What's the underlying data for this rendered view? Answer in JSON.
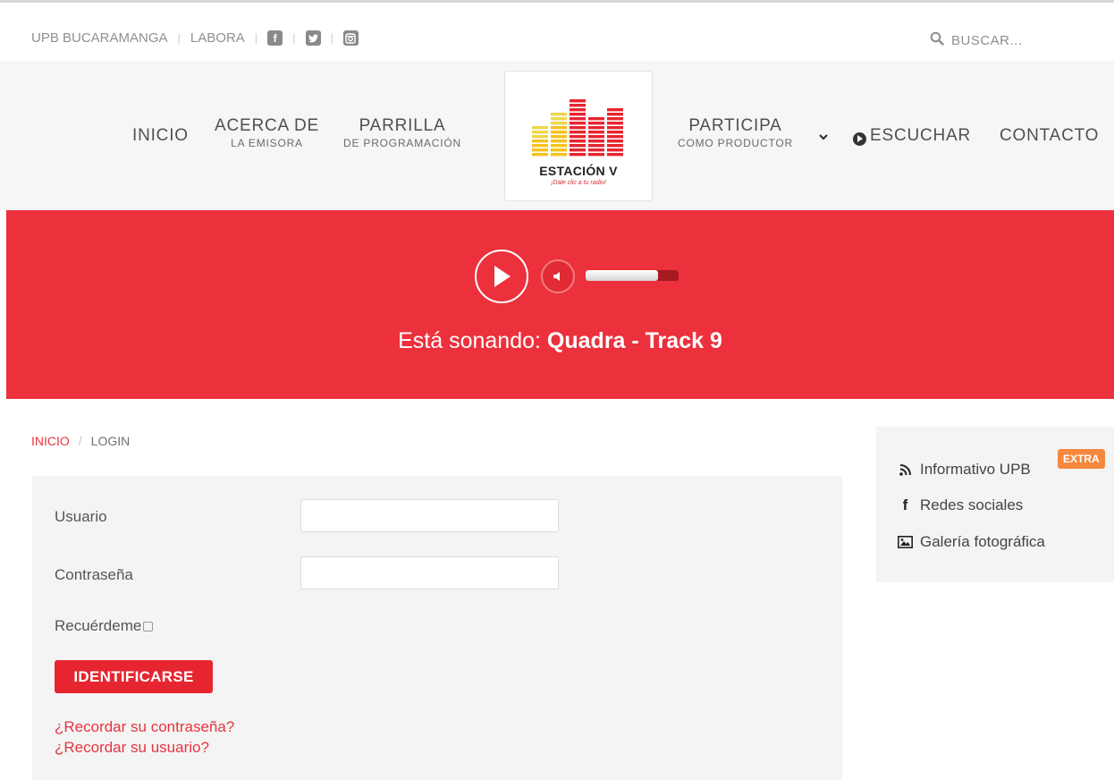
{
  "topbar": {
    "links": [
      "UPB BUCARAMANGA",
      "LABORA"
    ],
    "social_icons": [
      "facebook-icon",
      "twitter-icon",
      "instagram-icon"
    ],
    "search_placeholder": "BUSCAR..."
  },
  "nav": {
    "inicio": "INICIO",
    "acerca_main": "ACERCA DE",
    "acerca_sub": "LA EMISORA",
    "parrilla_main": "PARRILLA",
    "parrilla_sub": "DE PROGRAMACIÓN",
    "participa_main": "PARTICIPA",
    "participa_sub": "COMO PRODUCTOR",
    "escuchar": "ESCUCHAR",
    "contacto": "CONTACTO"
  },
  "logo": {
    "name": "ESTACIÓN V",
    "tagline": "¡Dale clic a tu radio!"
  },
  "player": {
    "prefix": "Está sonando:",
    "track": "Quadra - Track 9",
    "volume_level": 0.78
  },
  "breadcrumb": {
    "home": "INICIO",
    "current": "LOGIN"
  },
  "login": {
    "username_label": "Usuario",
    "password_label": "Contraseña",
    "username_value": "",
    "password_value": "",
    "remember_label": "Recuérdeme",
    "submit_label": "IDENTIFICARSE",
    "forgot_password": "¿Recordar su contraseña?",
    "forgot_username": "¿Recordar su usuario?"
  },
  "sidebar": {
    "items": [
      "Informativo UPB",
      "Redes sociales",
      "Galería fotográfica"
    ],
    "badge": "EXTRA"
  },
  "colors": {
    "brand_red": "#ec313c",
    "button_red": "#e62530",
    "badge_orange": "#f6883e"
  }
}
